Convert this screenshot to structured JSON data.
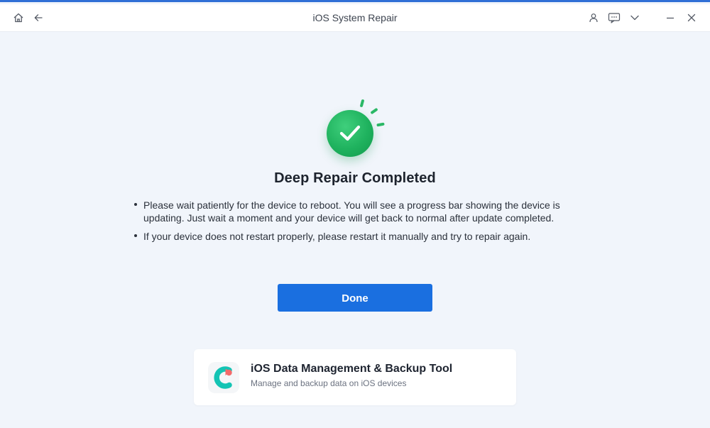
{
  "window": {
    "title": "iOS System Repair",
    "accent": "#1a6fe0"
  },
  "titlebar_icons": {
    "left": [
      "home-icon",
      "back-arrow-icon"
    ],
    "right": [
      "account-icon",
      "feedback-icon",
      "menu-dropdown-icon",
      "minimize-icon",
      "close-icon"
    ]
  },
  "main": {
    "status_icon": "success-check-icon",
    "status_color": "#1fb25e",
    "heading": "Deep Repair Completed",
    "bullets": [
      "Please wait patiently for the device to reboot. You will see a progress bar showing the device is updating. Just wait a moment and your device will get back to normal after update completed.",
      "If your device does not restart properly, please restart it manually and try to repair again."
    ],
    "done_label": "Done"
  },
  "promo": {
    "icon": "data-backup-app-icon",
    "title": "iOS Data Management & Backup Tool",
    "subtitle": "Manage and backup data on iOS devices"
  }
}
